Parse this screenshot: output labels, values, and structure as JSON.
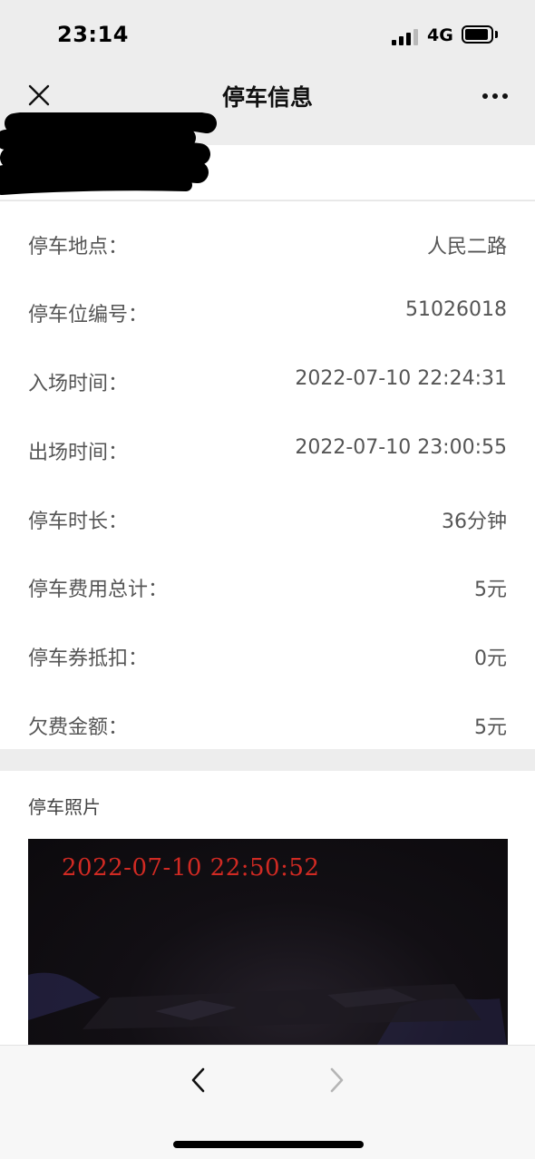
{
  "status_bar": {
    "time": "23:14",
    "network": "4G",
    "signal_bars": 3,
    "battery_level": 0.8
  },
  "nav": {
    "title": "停车信息",
    "close_icon": "close-icon",
    "more_icon": "more-dots-icon"
  },
  "parking_info": {
    "rows": [
      {
        "label": "停车地点：",
        "value": "人民二路"
      },
      {
        "label": "停车位编号：",
        "value": "51026018"
      },
      {
        "label": "入场时间：",
        "value": "2022-07-10 22:24:31"
      },
      {
        "label": "出场时间：",
        "value": "2022-07-10 23:00:55"
      },
      {
        "label": "停车时长：",
        "value": "36分钟"
      },
      {
        "label": "停车费用总计：",
        "value": "5元"
      },
      {
        "label": "停车券抵扣：",
        "value": "0元"
      },
      {
        "label": "欠费金额：",
        "value": "5元"
      }
    ]
  },
  "photo_section": {
    "title": "停车照片",
    "timestamp": "2022-07-10 22:50:52"
  },
  "toolbar": {
    "back_icon": "chevron-left-icon",
    "forward_icon": "chevron-right-icon"
  },
  "colors": {
    "page_bg": "#ededed",
    "card_bg": "#ffffff",
    "stamp_red": "#d12a23",
    "disabled_icon": "#b5b5b5"
  }
}
